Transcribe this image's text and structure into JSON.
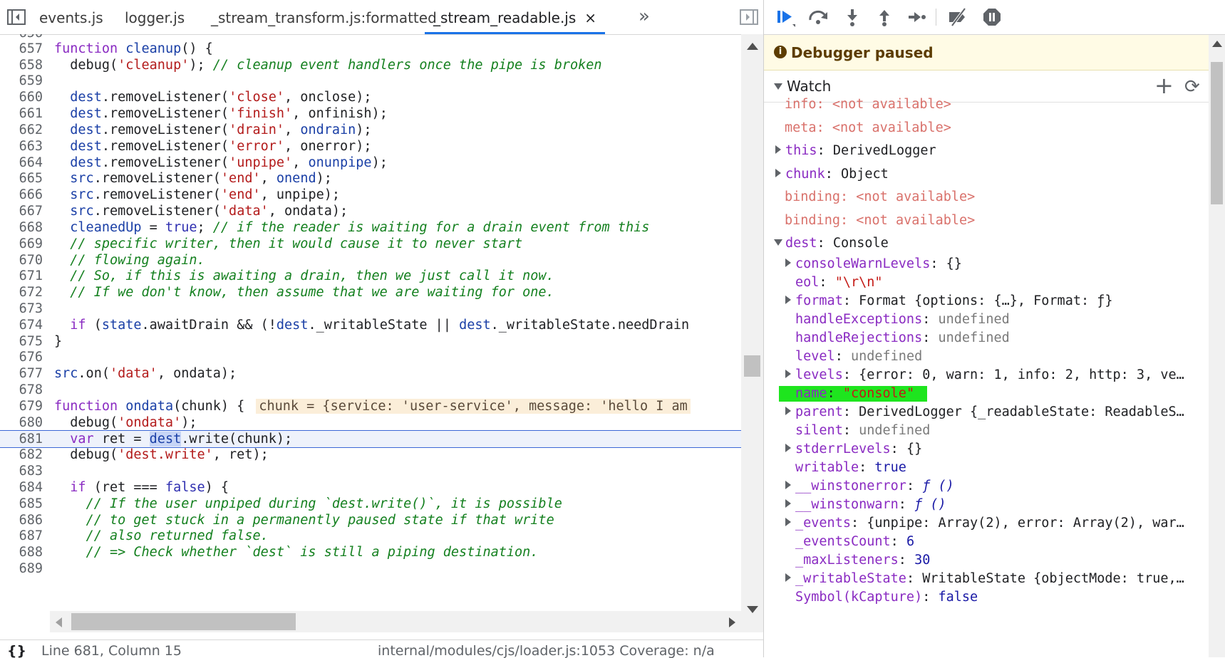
{
  "tabs": [
    {
      "label": "events.js",
      "active": false
    },
    {
      "label": "logger.js",
      "active": false
    },
    {
      "label": "_stream_transform.js:formatted",
      "active": false
    },
    {
      "label": "_stream_readable.js",
      "active": true,
      "close": "×"
    }
  ],
  "tabs_more": "»",
  "code_lines": [
    {
      "num": "657"
    },
    {
      "num": "658"
    },
    {
      "num": "659"
    },
    {
      "num": "660"
    },
    {
      "num": "661"
    },
    {
      "num": "662"
    },
    {
      "num": "663"
    },
    {
      "num": "664"
    },
    {
      "num": "665"
    },
    {
      "num": "666"
    },
    {
      "num": "667"
    },
    {
      "num": "668"
    },
    {
      "num": "669"
    },
    {
      "num": "670"
    },
    {
      "num": "671"
    },
    {
      "num": "672"
    },
    {
      "num": "673"
    },
    {
      "num": "674"
    },
    {
      "num": "675"
    },
    {
      "num": "676"
    },
    {
      "num": "677"
    },
    {
      "num": "678"
    },
    {
      "num": "679"
    },
    {
      "num": "680"
    },
    {
      "num": "681"
    },
    {
      "num": "682"
    },
    {
      "num": "683"
    },
    {
      "num": "684"
    },
    {
      "num": "685"
    },
    {
      "num": "686"
    },
    {
      "num": "687"
    },
    {
      "num": "688"
    },
    {
      "num": "689"
    }
  ],
  "inline_value": "chunk = {service: 'user-service', message: 'hello I am",
  "status": {
    "icon": "{}",
    "position": "Line 681, Column 15",
    "info": "internal/modules/cjs/loader.js:1053  Coverage: n/a"
  },
  "debugger": {
    "paused_text": "Debugger paused",
    "watch_label": "Watch"
  },
  "watch": {
    "info": {
      "key": "info",
      "value": "<not available>"
    },
    "meta": {
      "key": "meta",
      "value": "<not available>"
    },
    "this": {
      "key": "this",
      "value": "DerivedLogger"
    },
    "chunk": {
      "key": "chunk",
      "value": "Object"
    },
    "binding1": {
      "key": "binding",
      "value": "<not available>"
    },
    "binding2": {
      "key": "binding",
      "value": "<not available>"
    },
    "dest": {
      "key": "dest",
      "value": "Console"
    }
  },
  "dest_props": {
    "consoleWarnLevels": {
      "key": "consoleWarnLevels",
      "value": "{}"
    },
    "eol": {
      "key": "eol",
      "value": "\"\\r\\n\""
    },
    "format": {
      "key": "format",
      "value": "Format {options: {…}, Format: ƒ}"
    },
    "handleExceptions": {
      "key": "handleExceptions",
      "value": "undefined"
    },
    "handleRejections": {
      "key": "handleRejections",
      "value": "undefined"
    },
    "level": {
      "key": "level",
      "value": "undefined"
    },
    "levels": {
      "key": "levels",
      "value": "{error: 0, warn: 1, info: 2, http: 3, ve…"
    },
    "name": {
      "key": "name",
      "value": "\"console\""
    },
    "parent": {
      "key": "parent",
      "value": "DerivedLogger {_readableState: ReadableS…"
    },
    "silent": {
      "key": "silent",
      "value": "undefined"
    },
    "stderrLevels": {
      "key": "stderrLevels",
      "value": "{}"
    },
    "writable": {
      "key": "writable",
      "value": "true"
    },
    "winstonerror": {
      "key": "__winstonerror",
      "value": "ƒ ()"
    },
    "winstonwarn": {
      "key": "__winstonwarn",
      "value": "ƒ ()"
    },
    "events": {
      "key": "_events",
      "value": "{unpipe: Array(2), error: Array(2), war…"
    },
    "eventsCount": {
      "key": "_eventsCount",
      "value": "6"
    },
    "maxListeners": {
      "key": "_maxListeners",
      "value": "30"
    },
    "writableState": {
      "key": "_writableState",
      "value": "WritableState {objectMode: true,…"
    },
    "symbol": {
      "key": "Symbol(kCapture)",
      "value": "false"
    }
  }
}
